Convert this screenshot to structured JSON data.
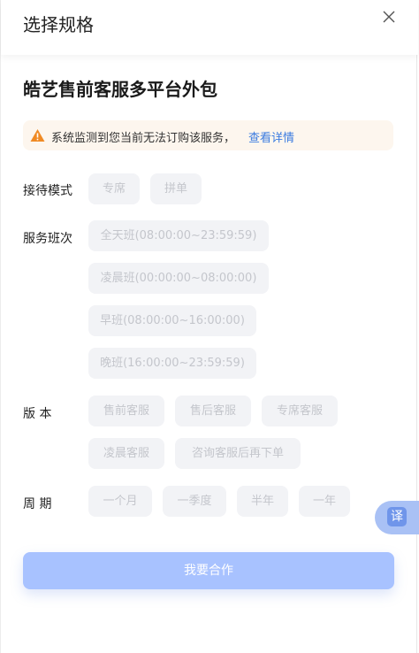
{
  "header": {
    "title": "选择规格"
  },
  "product": {
    "title": "皓艺售前客服多平台外包"
  },
  "notice": {
    "text": "系统监测到您当前无法订购该服务，",
    "link": "查看详情"
  },
  "sections": {
    "reception": {
      "label": "接待模式",
      "options": [
        "专席",
        "拼单"
      ]
    },
    "shift": {
      "label": "服务班次",
      "options": [
        "全天班(08:00:00~23:59:59)",
        "凌晨班(00:00:00~08:00:00)",
        "早班(08:00:00~16:00:00)",
        "晚班(16:00:00~23:59:59)"
      ]
    },
    "version": {
      "label": "版 本",
      "options": [
        "售前客服",
        "售后客服",
        "专席客服",
        "凌晨客服",
        "咨询客服后再下单"
      ]
    },
    "period": {
      "label": "周 期",
      "options": [
        "一个月",
        "一季度",
        "半年",
        "一年"
      ]
    }
  },
  "cta": {
    "label": "我要合作"
  },
  "translate": {
    "label": "译"
  },
  "colors": {
    "accent": "#3a7be0",
    "cta": "#a8c2ff",
    "chip_bg": "#f2f3f6",
    "notice_bg": "#fdf6ee",
    "warning": "#f08a24"
  },
  "icons": [
    "close-icon",
    "warning-icon",
    "translate-icon"
  ]
}
